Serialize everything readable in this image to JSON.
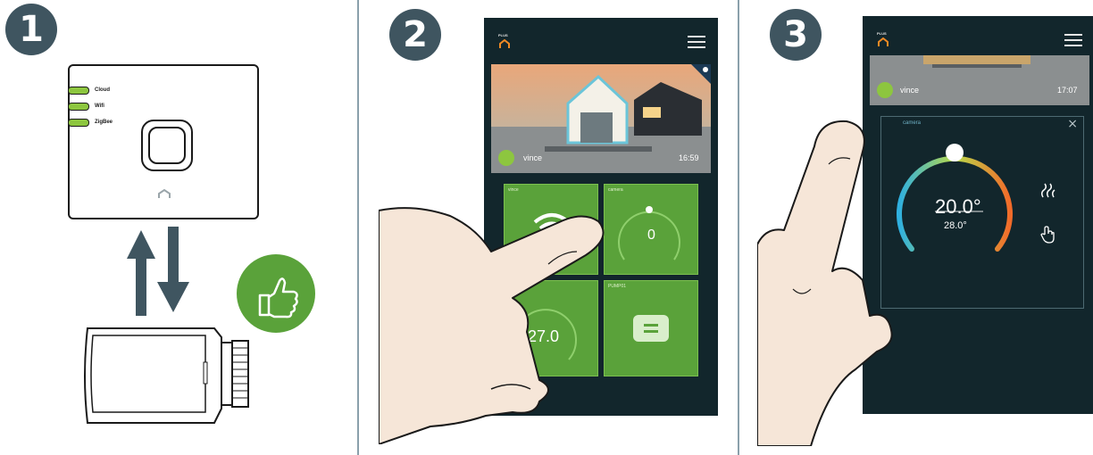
{
  "steps": [
    "1",
    "2",
    "3"
  ],
  "gateway": {
    "leds": [
      "Cloud",
      "Wifi",
      "ZigBee"
    ]
  },
  "screen2": {
    "brand": "PLUS",
    "photo_user": "vince",
    "photo_time": "16:59",
    "tiles": [
      {
        "label": "vince"
      },
      {
        "label": "camera",
        "value": "0"
      },
      {
        "label": "",
        "value": "27.0"
      },
      {
        "label": "PUMP01"
      }
    ]
  },
  "screen3": {
    "brand": "PLUS",
    "photo_user": "vince",
    "photo_time": "17:07",
    "card_label": "camera",
    "temperature": "20.0°",
    "setpoint": "28.0°"
  },
  "colors": {
    "badge": "#3f5560",
    "led": "#8dc63f",
    "tile": "#5aa23a",
    "screen": "#12262c",
    "arrow": "#3f5560"
  }
}
